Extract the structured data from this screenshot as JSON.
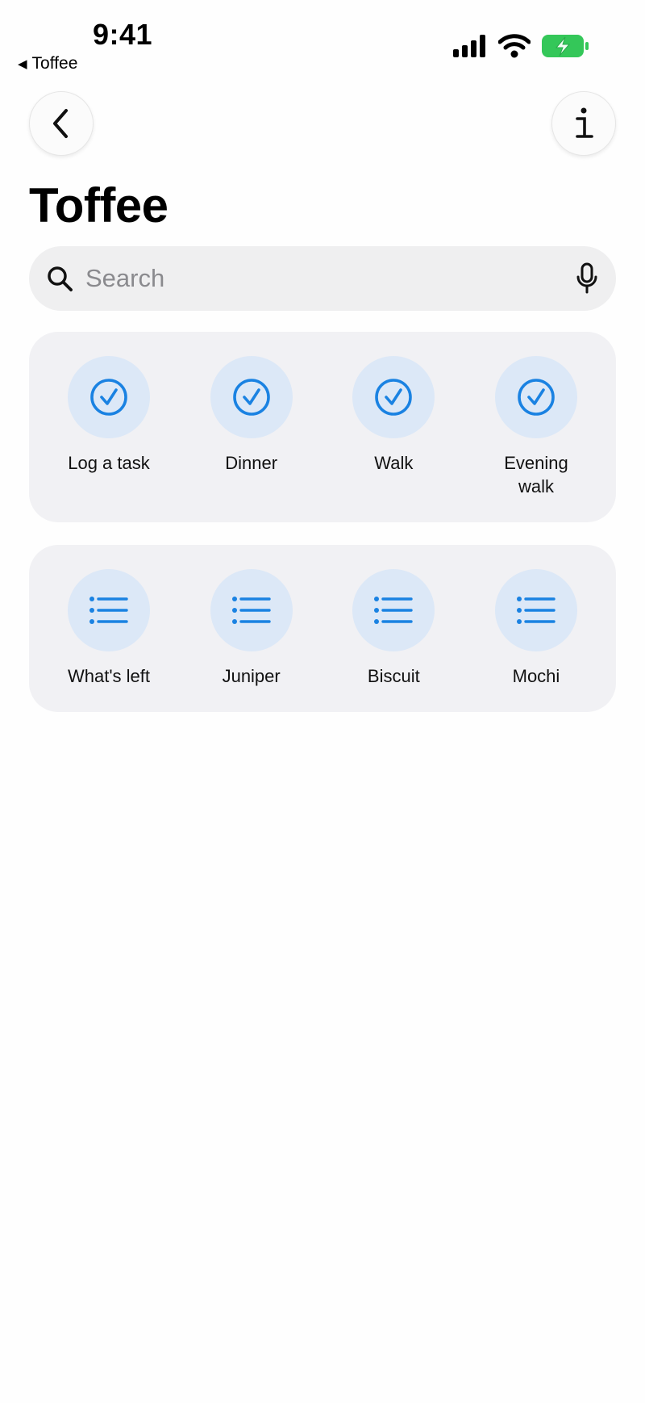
{
  "status_bar": {
    "time": "9:41",
    "back_app": "Toffee",
    "icons": [
      "cellular-signal-icon",
      "wifi-icon",
      "battery-charging-icon"
    ]
  },
  "nav": {
    "back_icon": "chevron-left-icon",
    "info_icon": "info-icon"
  },
  "title": "Toffee",
  "search": {
    "placeholder": "Search",
    "icon": "search-icon",
    "mic_icon": "microphone-icon"
  },
  "actions": [
    {
      "label": "Log a task",
      "icon": "checkmark-circle-icon"
    },
    {
      "label": "Dinner",
      "icon": "checkmark-circle-icon"
    },
    {
      "label": "Walk",
      "icon": "checkmark-circle-icon"
    },
    {
      "label": "Evening walk",
      "icon": "checkmark-circle-icon"
    }
  ],
  "lists": [
    {
      "label": "What's left",
      "icon": "list-icon"
    },
    {
      "label": "Juniper",
      "icon": "list-icon"
    },
    {
      "label": "Biscuit",
      "icon": "list-icon"
    },
    {
      "label": "Mochi",
      "icon": "list-icon"
    }
  ],
  "colors": {
    "accent": "#1a82e2",
    "bubble": "#dce8f7",
    "card": "#f1f1f4",
    "battery": "#34c759"
  }
}
